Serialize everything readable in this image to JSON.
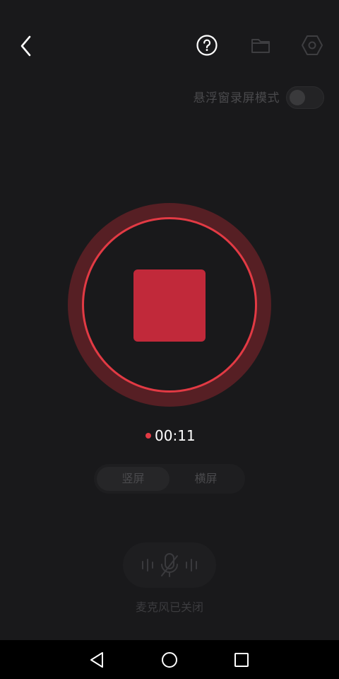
{
  "header": {
    "back_icon": "chevron-left-icon",
    "help_icon": "help-circle-icon",
    "folder_icon": "folder-icon",
    "settings_icon": "hexagon-settings-icon"
  },
  "floating_mode": {
    "label": "悬浮窗录屏模式",
    "enabled": false
  },
  "recorder": {
    "state": "recording",
    "accent_color": "#e23a44",
    "stop_color": "#c1293a",
    "ring_color": "#561f24",
    "elapsed": "00:11"
  },
  "orientation": {
    "options": [
      "竖屏",
      "横屏"
    ],
    "selected": "竖屏"
  },
  "microphone": {
    "icon": "mic-off-icon",
    "status_label": "麦克风已关闭"
  },
  "system_nav": {
    "back_icon": "triangle-back-icon",
    "home_icon": "circle-home-icon",
    "recents_icon": "square-recents-icon"
  }
}
